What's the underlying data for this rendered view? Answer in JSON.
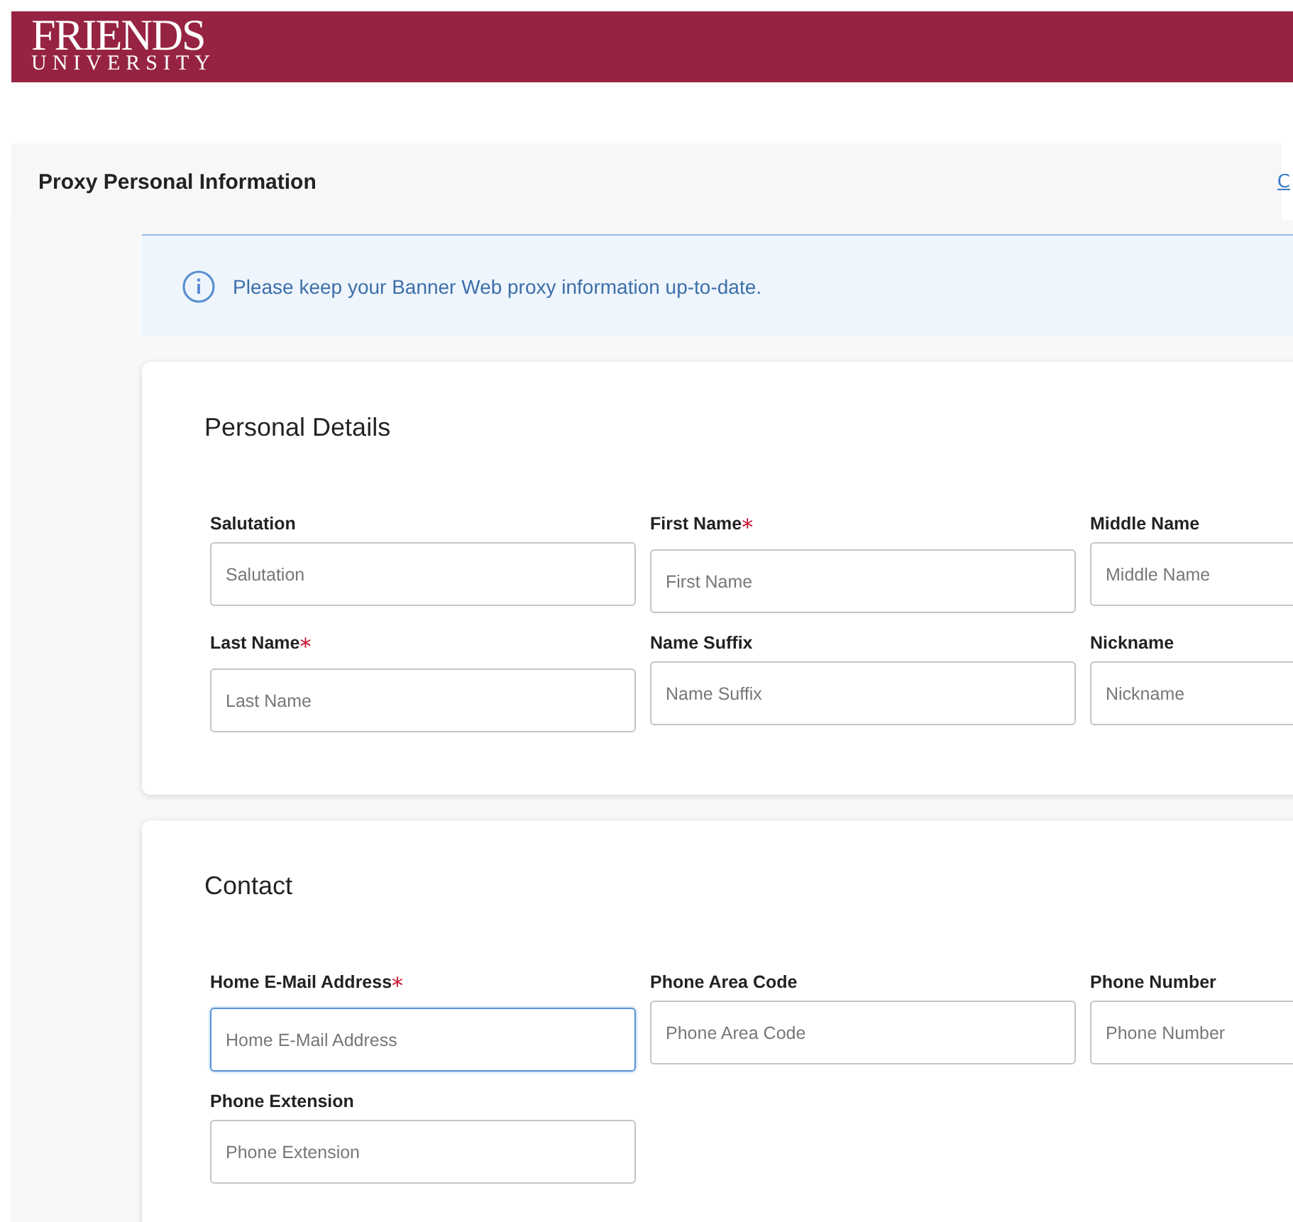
{
  "header": {
    "logo_top": "FRIENDS",
    "logo_bottom": "UNIVERSITY"
  },
  "page_title": "Proxy Personal Information",
  "top_link": "C",
  "required_mark": "*",
  "notice": "Please keep your Banner Web proxy information up-to-date.",
  "sections": [
    {
      "title": "Personal Details",
      "fields": [
        {
          "label": "Salutation",
          "required": false,
          "placeholder": "Salutation",
          "focused": false
        },
        {
          "label": "First Name",
          "required": true,
          "placeholder": "First Name",
          "focused": false
        },
        {
          "label": "Middle Name",
          "required": false,
          "placeholder": "Middle Name",
          "focused": false
        },
        {
          "label": "Last Name",
          "required": true,
          "placeholder": "Last Name",
          "focused": false
        },
        {
          "label": "Name Suffix",
          "required": false,
          "placeholder": "Name Suffix",
          "focused": false
        },
        {
          "label": "Nickname",
          "required": false,
          "placeholder": "Nickname",
          "focused": false
        }
      ]
    },
    {
      "title": "Contact",
      "fields": [
        {
          "label": "Home E-Mail Address",
          "required": true,
          "placeholder": "Home E-Mail Address",
          "focused": true
        },
        {
          "label": "Phone Area Code",
          "required": false,
          "placeholder": "Phone Area Code",
          "focused": false
        },
        {
          "label": "Phone Number",
          "required": false,
          "placeholder": "Phone Number",
          "focused": false
        },
        {
          "label": "Phone Extension",
          "required": false,
          "placeholder": "Phone Extension",
          "focused": false
        }
      ]
    }
  ]
}
